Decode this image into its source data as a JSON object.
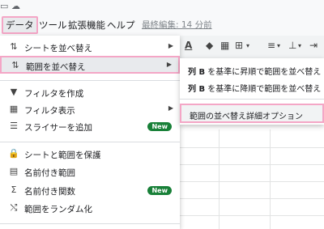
{
  "menubar": {
    "items": [
      {
        "label": "データ",
        "active": true
      },
      {
        "label": "ツール"
      },
      {
        "label": "拡張機能"
      },
      {
        "label": "ヘルプ"
      }
    ],
    "last_edit": "最終編集: 14 分前"
  },
  "dropdown": {
    "items": [
      {
        "icon": "sort-icon",
        "glyph": "⇅",
        "label": "シートを並べ替え",
        "submenu": true
      },
      {
        "icon": "sort-range-icon",
        "glyph": "⇅",
        "label": "範囲を並べ替え",
        "submenu": true,
        "highlighted": true
      },
      {
        "icon": "filter-icon",
        "glyph": "▼",
        "label": "フィルタを作成"
      },
      {
        "icon": "filter-view-icon",
        "glyph": "▦",
        "label": "フィルタ表示",
        "submenu": true
      },
      {
        "icon": "slicer-icon",
        "glyph": "☰",
        "label": "スライサーを追加",
        "badge": "New"
      },
      {
        "icon": "lock-icon",
        "glyph": "🔒",
        "label": "シートと範囲を保護"
      },
      {
        "icon": "named-range-icon",
        "glyph": "▤",
        "label": "名前付き範囲"
      },
      {
        "icon": "sigma-icon",
        "glyph": "Σ",
        "label": "名前付き関数",
        "badge": "New"
      },
      {
        "icon": "shuffle-icon",
        "glyph": "⤭",
        "label": "範囲をランダム化"
      }
    ]
  },
  "submenu": {
    "items": [
      {
        "prefix": "列 B",
        "label": " を基準に昇順で範囲を並べ替え"
      },
      {
        "prefix": "列 B",
        "label": " を基準に降順で範囲を並べ替え"
      },
      {
        "prefix": "",
        "label": "範囲の並べ替え詳細オプション",
        "highlighted": true
      }
    ]
  },
  "colors": {
    "highlight_border": "#f4a6c6",
    "new_badge": "#188038"
  }
}
